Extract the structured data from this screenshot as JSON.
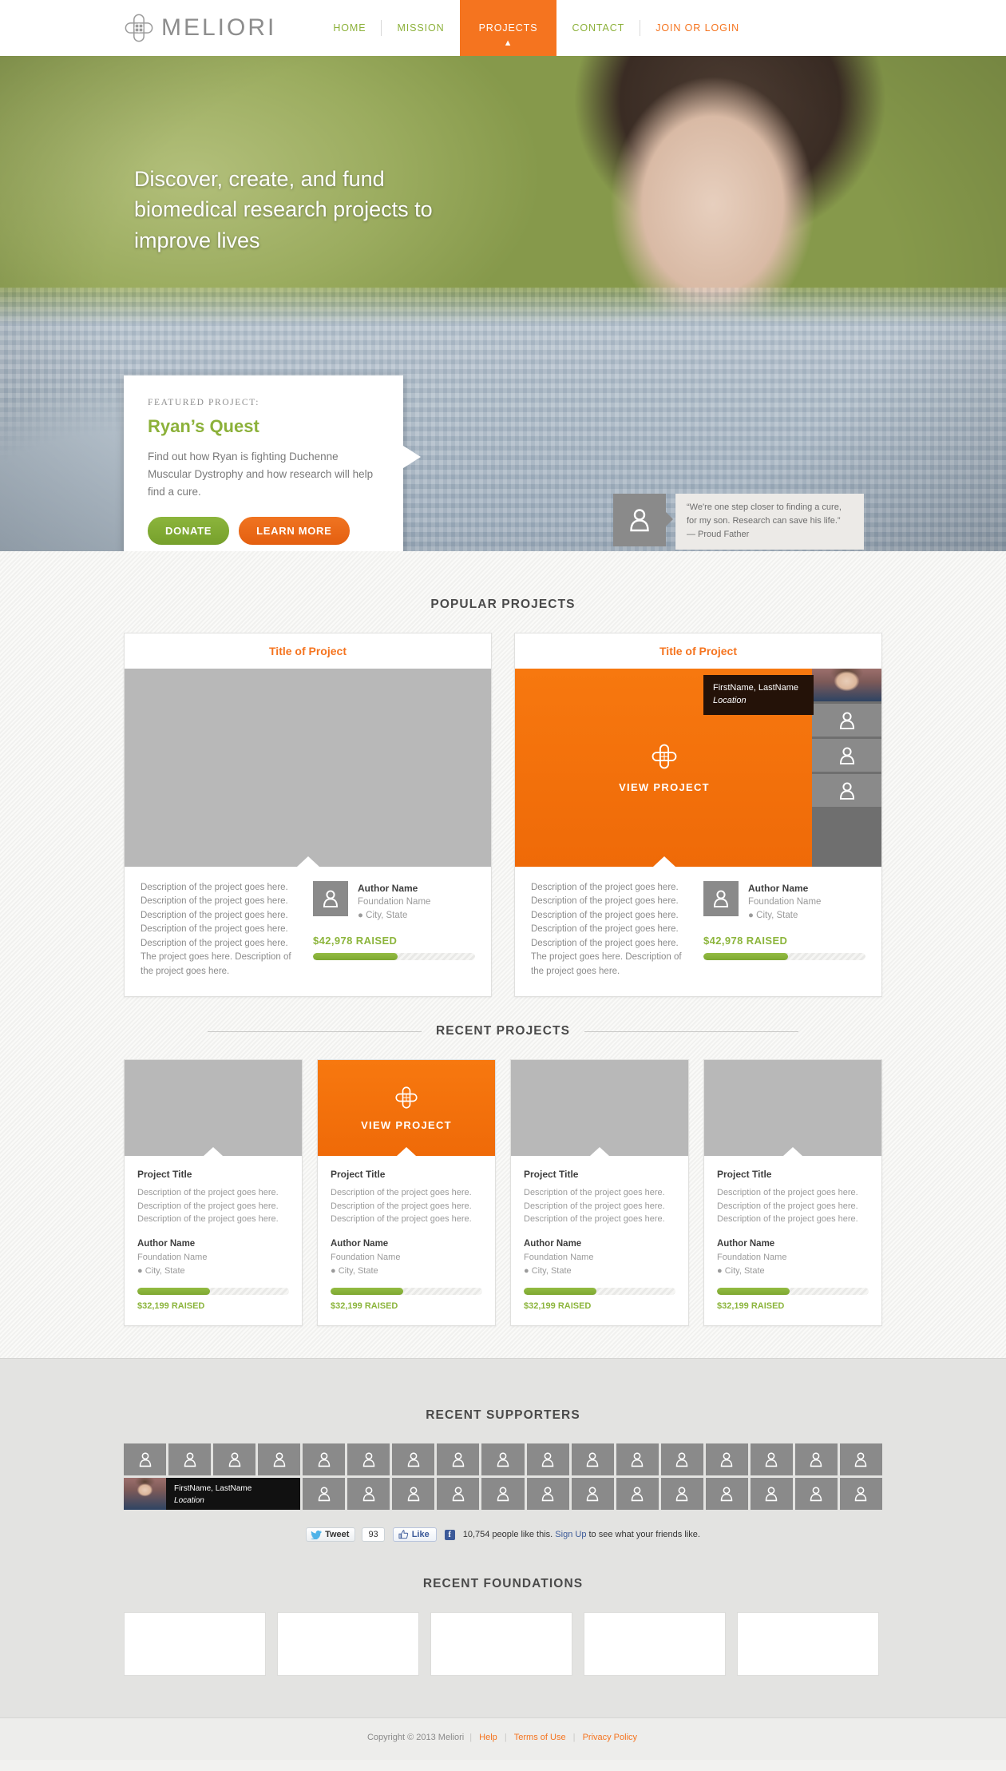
{
  "brand": {
    "name": "MELIORI",
    "logo_icon": "meliori-cross-icon"
  },
  "nav": {
    "items": [
      {
        "label": "HOME",
        "state": "default"
      },
      {
        "label": "MISSION",
        "state": "default"
      },
      {
        "label": "PROJECTS",
        "state": "active"
      },
      {
        "label": "CONTACT",
        "state": "default"
      },
      {
        "label": "JOIN OR LOGIN",
        "state": "accent"
      }
    ]
  },
  "hero": {
    "headline": "Discover, create, and fund biomedical research projects to improve lives",
    "featured": {
      "kicker": "FEATURED PROJECT:",
      "title": "Ryan’s Quest",
      "description": "Find out how Ryan is fighting Duchenne Muscular Dystrophy and how research will help find a cure.",
      "donate_label": "DONATE",
      "learn_label": "LEARN MORE"
    },
    "testimonial": {
      "quote": "“We're one step closer to finding a cure, for my son. Research can save his life.”",
      "attribution": "— Proud Father"
    }
  },
  "popular": {
    "heading": "POPULAR PROJECTS",
    "cards": [
      {
        "title": "Title of Project",
        "media": "gray",
        "description": "Description of the project goes here. Description of the project goes here. Description of the project goes here. Description of the project goes here. Description of the project goes here. The project goes here. Description of the project goes here.",
        "author": "Author Name",
        "foundation": "Foundation Name",
        "location": "City, State",
        "raised": "$42,978 RAISED",
        "progress_pct": 52
      },
      {
        "title": "Title of Project",
        "media": "orange",
        "view_label": "VIEW PROJECT",
        "tooltip_name": "FirstName, LastName",
        "tooltip_location": "Location",
        "description": "Description of the project goes here. Description of the project goes here. Description of the project goes here. Description of the project goes here. Description of the project goes here. The project goes here. Description of the project goes here.",
        "author": "Author Name",
        "foundation": "Foundation Name",
        "location": "City, State",
        "raised": "$42,978 RAISED",
        "progress_pct": 52
      }
    ]
  },
  "recent": {
    "heading": "RECENT PROJECTS",
    "cards": [
      {
        "media": "gray",
        "title": "Project Title",
        "description": "Description of the project goes here. Description of the project goes here. Description of the project goes here.",
        "author": "Author Name",
        "foundation": "Foundation Name",
        "location": "City, State",
        "raised": "$32,199 RAISED",
        "progress_pct": 48
      },
      {
        "media": "orange",
        "view_label": "VIEW PROJECT",
        "title": "Project Title",
        "description": "Description of the project goes here. Description of the project goes here. Description of the project goes here.",
        "author": "Author Name",
        "foundation": "Foundation Name",
        "location": "City, State",
        "raised": "$32,199 RAISED",
        "progress_pct": 48
      },
      {
        "media": "gray",
        "title": "Project Title",
        "description": "Description of the project goes here. Description of the project goes here. Description of the project goes here.",
        "author": "Author Name",
        "foundation": "Foundation Name",
        "location": "City, State",
        "raised": "$32,199 RAISED",
        "progress_pct": 48
      },
      {
        "media": "gray",
        "title": "Project Title",
        "description": "Description of the project goes here. Description of the project goes here. Description of the project goes here.",
        "author": "Author Name",
        "foundation": "Foundation Name",
        "location": "City, State",
        "raised": "$32,199 RAISED",
        "progress_pct": 48
      }
    ]
  },
  "supporters": {
    "heading": "RECENT SUPPORTERS",
    "columns": 17,
    "rows": 2,
    "highlight": {
      "row": 1,
      "col": 0,
      "name": "FirstName, LastName",
      "location": "Location"
    },
    "social": {
      "tweet_label": "Tweet",
      "tweet_count": "93",
      "like_label": "Like",
      "fb_glyph": "f",
      "like_text_before": "10,754 people like this.",
      "sign_up_label": "Sign Up",
      "like_text_after": "to see what your friends like."
    }
  },
  "foundations": {
    "heading": "RECENT FOUNDATIONS",
    "count": 5
  },
  "footer": {
    "copyright": "Copyright © 2013 Meliori",
    "links": [
      "Help",
      "Terms of Use",
      "Privacy Policy"
    ]
  },
  "colors": {
    "orange": "#f5741f",
    "green": "#8cb53c",
    "gray": "#8a8a8a",
    "dark": "#3f3f3f"
  }
}
